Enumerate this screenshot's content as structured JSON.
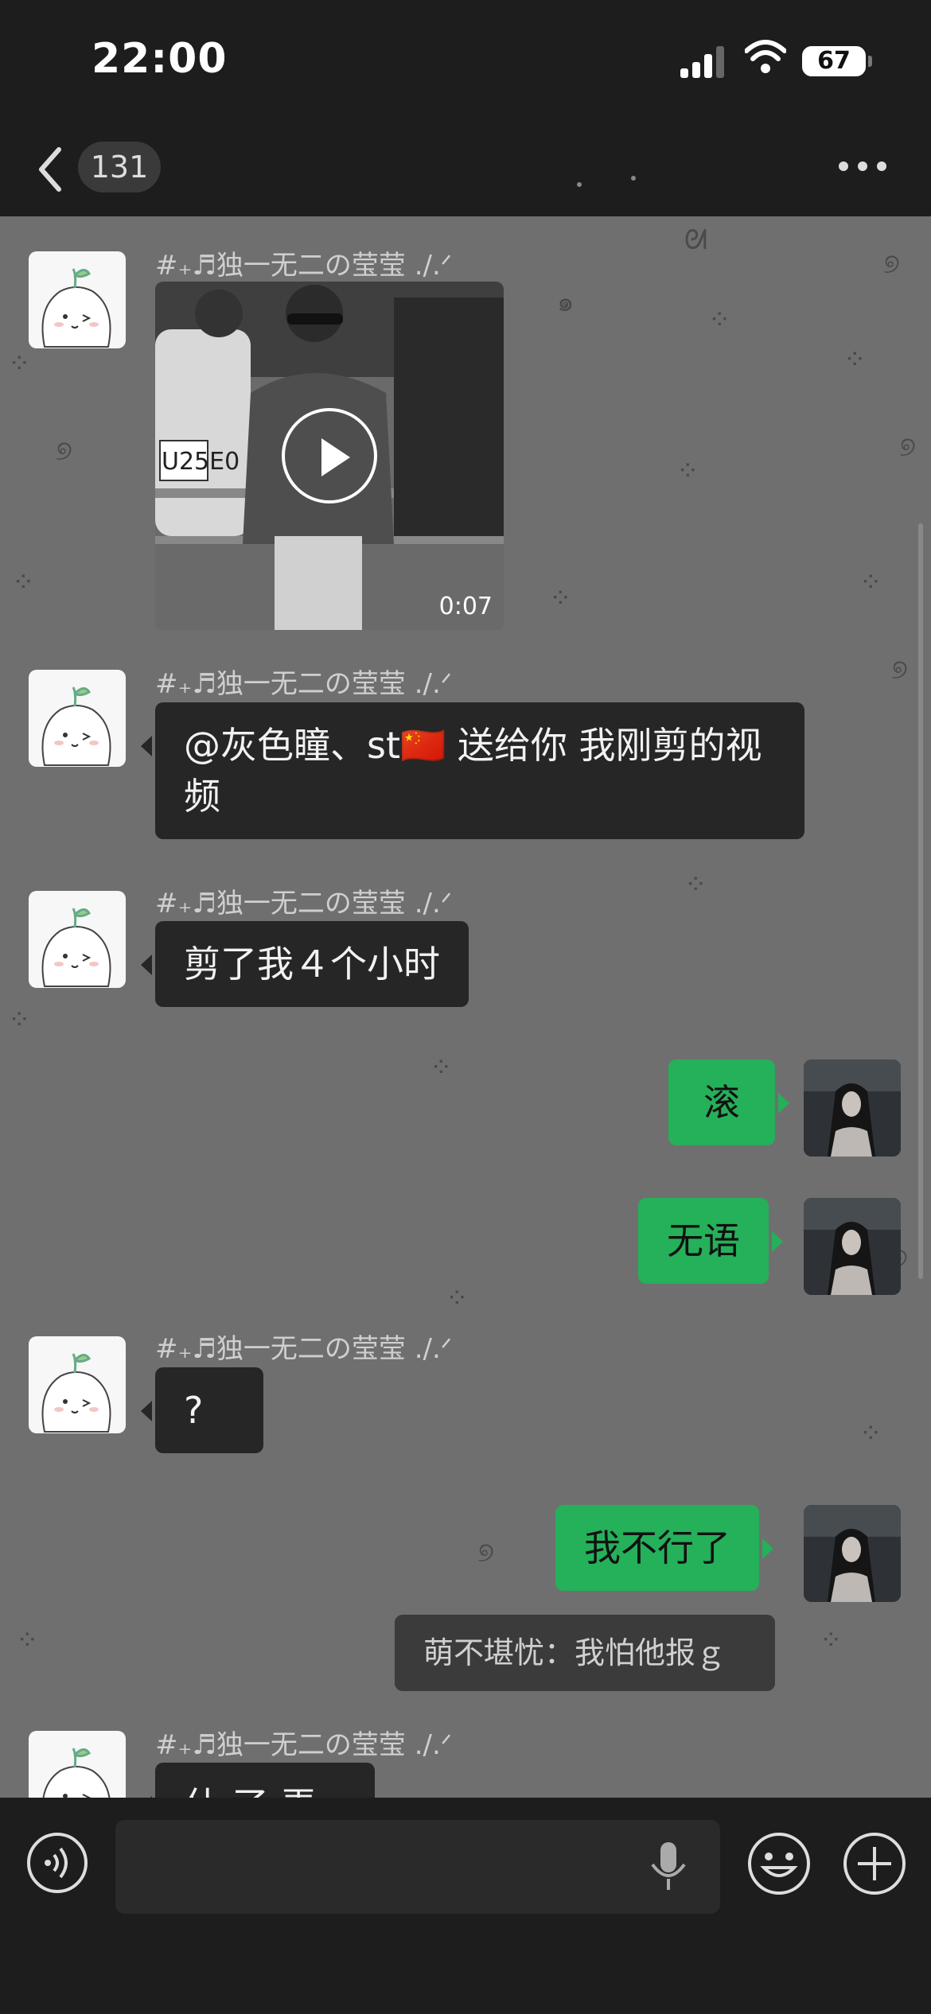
{
  "status_bar": {
    "time": "22:00",
    "battery": "67"
  },
  "nav": {
    "unread_count": "131"
  },
  "messages": {
    "sender_name": "#₊♬独一无二の莹莹 ./.ᐟ",
    "video_duration": "0:07",
    "text_1": "@灰色瞳、st🇨🇳 送给你 我刚剪的视频",
    "text_2": "剪了我４个小时",
    "reply_1": "滚",
    "reply_2": "无语",
    "text_3": "?",
    "reply_3": "我不行了",
    "quote": "萌不堪忧：我怕他报ｇ",
    "text_4_partial": "什 了 弄 了"
  },
  "colors": {
    "green_bubble": "#25b05a",
    "dark_bubble": "#262626",
    "chat_background": "#6f6f6f"
  }
}
